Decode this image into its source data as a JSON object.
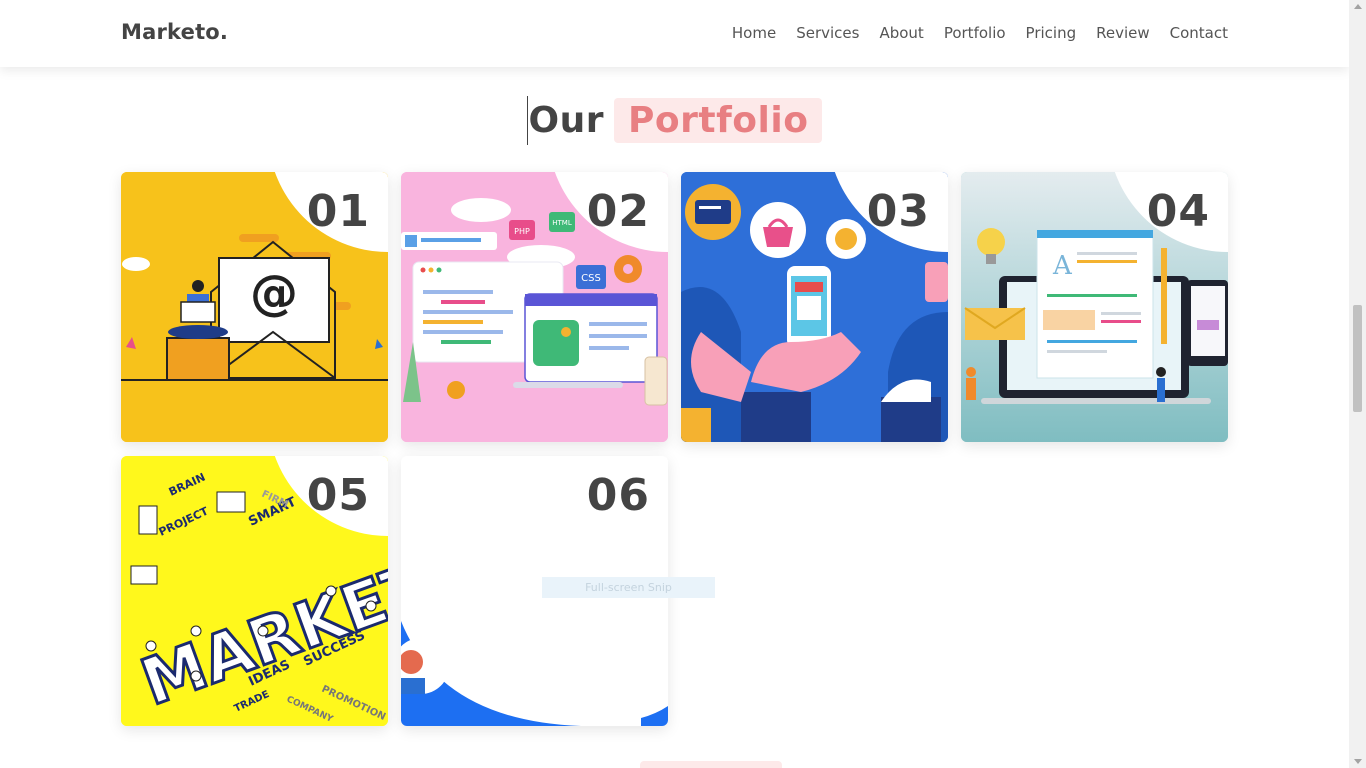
{
  "header": {
    "logo": "Marketo.",
    "nav": [
      "Home",
      "Services",
      "About",
      "Portfolio",
      "Pricing",
      "Review",
      "Contact"
    ]
  },
  "heading": {
    "word1": "Our",
    "word2": "Portfolio"
  },
  "cards": [
    {
      "num": "01",
      "theme": "email-marketing",
      "bg": "#f7c21b"
    },
    {
      "num": "02",
      "theme": "web-development",
      "bg": "#f9b4de"
    },
    {
      "num": "03",
      "theme": "mobile-shopping",
      "bg": "#2e6fd8"
    },
    {
      "num": "04",
      "theme": "content-writing",
      "bg": "#8fc7c9"
    },
    {
      "num": "05",
      "theme": "marketing-isometric",
      "bg": "#fff81c",
      "words": [
        "BRAIN",
        "PROJECT",
        "SMART",
        "FIRM",
        "MARKET",
        "IDEAS",
        "SUCCESS",
        "TRADE",
        "PROMOTION",
        "COMPANY"
      ]
    },
    {
      "num": "06",
      "theme": "team-blue-wave",
      "bg": "#ffffff"
    }
  ],
  "snip": {
    "label": "Full-screen Snip"
  },
  "colors": {
    "accent": "#e87f82",
    "accent_bg": "#fde9e9",
    "text": "#444444"
  }
}
